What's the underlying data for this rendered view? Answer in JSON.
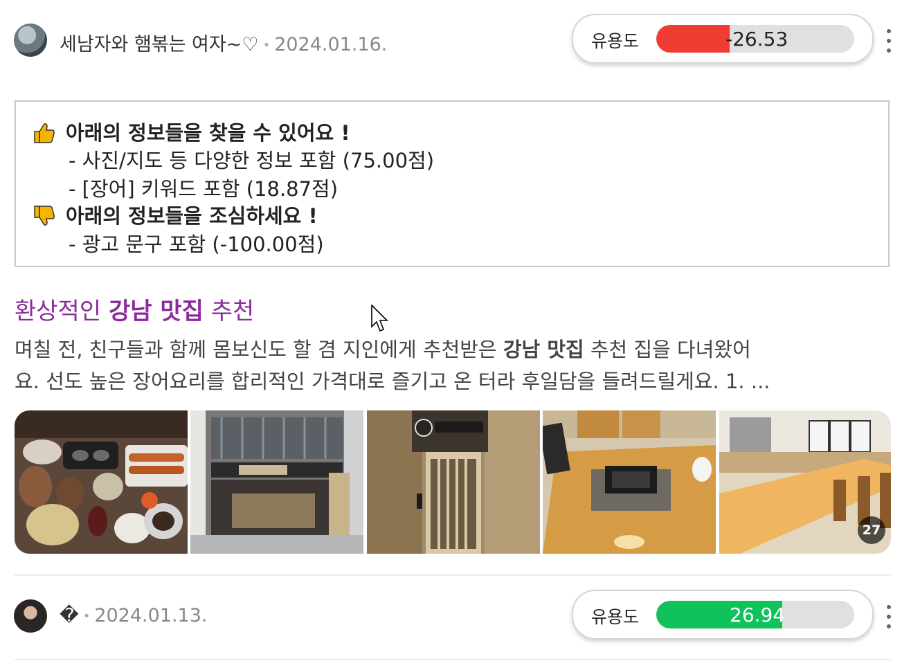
{
  "post1": {
    "author": "세남자와 햄볶는 여자~♡",
    "separator": "•",
    "date": "2024.01.16.",
    "useful_label": "유용도",
    "useful_value": "-26.53",
    "useful_fraction": 0.37,
    "useful_color": "#f03c32"
  },
  "info": {
    "positive_heading": "아래의 정보들을 찾을 수 있어요 !",
    "positive_items": [
      "- 사진/지도 등 다양한 정보 포함 (75.00점)",
      "- [장어] 키워드 포함 (18.87점)"
    ],
    "negative_heading": "아래의 정보들을 조심하세요 !",
    "negative_items": [
      "- 광고 문구 포함 (-100.00점)"
    ],
    "thumb_up_icon": "thumbs-up-icon",
    "thumb_down_icon": "thumbs-down-icon"
  },
  "article": {
    "title_pre": "환상적인 ",
    "title_bold": "강남 맛집",
    "title_post": " 추천",
    "snippet_line1_pre": "며칠 전, 친구들과 함께 몸보신도 할 겸 지인에게 추천받은 ",
    "snippet_line1_bold": "강남 맛집",
    "snippet_line1_post": " 추천 집을 다녀왔어",
    "snippet_line2": "요. 선도 높은 장어요리를 합리적인 가격대로 즐기고 온 터라 후일담을 들려드릴게요. 1. ...",
    "photo_count": "27",
    "photos": [
      "food-table-photo",
      "restaurant-exterior-photo",
      "restaurant-entrance-photo",
      "table-grill-photo",
      "bar-counter-photo"
    ]
  },
  "post2": {
    "author": "�",
    "separator": "•",
    "date": "2024.01.13.",
    "useful_label": "유용도",
    "useful_value": "26.94",
    "useful_fraction": 0.635,
    "useful_color": "#0fc25a"
  }
}
